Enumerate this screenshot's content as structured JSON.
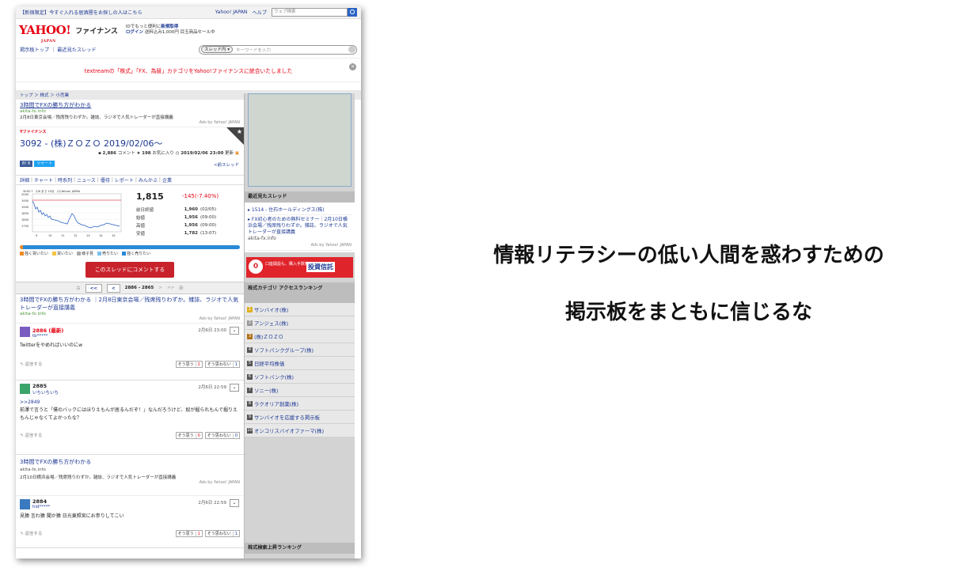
{
  "topbar": {
    "promo": "【新宿限定】今すぐ入れる居酒屋をお探しの人はこちら",
    "yahoo_link": "Yahoo! JAPAN",
    "help_link": "ヘルプ",
    "web_search_placeholder": "ウェブ検索"
  },
  "header": {
    "logo": "YAHOO!",
    "logo_sub": "JAPAN",
    "service": "ファイナンス",
    "login_line1": "IDでもっと便利に",
    "login_new": "新規取得",
    "login_label": "ログイン",
    "login_line2": "送料込み1,000円 目玉商品セール中"
  },
  "nav": {
    "links": "掲示板トップ ｜ 最近見たスレッド",
    "thread_scope": "スレッド内 ▾",
    "keyword_placeholder": "キーワードを入力"
  },
  "notice": {
    "text": "textreamの「株式」「FX、為替」カテゴリをYahoo!ファイナンスに統合いたしました"
  },
  "breadcrumb": "トップ ＞ 株式 ＞ 小売業",
  "ad1": {
    "title": "3時間でFXの勝ち方がわかる",
    "url": "akita-fx.info",
    "text": "2月8日東京会場／残席残りわずか。雑誌、ラジオで人気トレーダーが直接講義",
    "by": "Ads by Yahoo! JAPAN"
  },
  "stock": {
    "brand": "Yファイナンス",
    "title": "3092 - (株)ＺＯＺＯ 2019/02/06～",
    "comments": "2,886",
    "comments_label": "コメント",
    "favorites": "198",
    "favorites_label": "お気に入り",
    "updated": "2019/02/06 23:00",
    "updated_label": "更新",
    "fb": "B! 8",
    "tweet": "ツイート",
    "prev_thread": "<前スレッド"
  },
  "tabs": [
    "詳細",
    "チャート",
    "時系列",
    "ニュース",
    "優待",
    "レポート",
    "みんかぶ",
    "企業"
  ],
  "quote": {
    "price": "1,815",
    "change": "-145(-7.40%)",
    "chart_header": "3092.T　2/6 まで 15分　(C)Yahoo! JAPAN",
    "chart_y": [
      "2000",
      "1950",
      "1900",
      "1850",
      "1800",
      "1750"
    ],
    "chart_x": [
      "9",
      "10",
      "11",
      "12",
      "13",
      "14",
      "15"
    ],
    "rows": [
      {
        "label": "前日終値",
        "value": "1,960",
        "note": "(02/05)"
      },
      {
        "label": "始値",
        "value": "1,956",
        "note": "(09:00)"
      },
      {
        "label": "高値",
        "value": "1,956",
        "note": "(09:00)"
      },
      {
        "label": "安値",
        "value": "1,782",
        "note": "(13:07)"
      }
    ]
  },
  "sentiment_legend": [
    "強く買いたい",
    "買いたい",
    "様子見",
    "売りたい",
    "強く売りたい"
  ],
  "colors": {
    "sentiment": [
      "#f08a24",
      "#f5c342",
      "#aaaaaa",
      "#7cc0ee",
      "#2a8ad8"
    ],
    "accent_red": "#e60012",
    "link_blue": "#1d3994"
  },
  "comment_button": "このスレッドにコメントする",
  "pager": {
    "first": "古",
    "prev_all": "<<",
    "prev": "<",
    "range": "2886 - 2865",
    "next": ">",
    "next_all": ">>",
    "last": "新"
  },
  "ad2": {
    "title": "3時間でFXの勝ち方がわかる ｜2月8日東京会場／残席残りわずか。雑誌、ラジオで人気トレーダーが直接講義",
    "url": "akita-fx.info",
    "by": "Ads by Yahoo! JAPAN"
  },
  "posts": [
    {
      "num": "2886",
      "tag": "(最新)",
      "user": "tb*****",
      "time": "2月6日 23:00",
      "body": "Twitterをやめればいいのにw",
      "reply": "返信する",
      "agree": "そう思う",
      "agree_n": "2",
      "disagree": "そう思わない",
      "disagree_n": "1"
    },
    {
      "num": "2885",
      "tag": "",
      "user": "いちいちいち",
      "time": "2月6日 22:59",
      "quote": ">>2849",
      "body": "前澤で言うと「僕のバックにはほりえもんが居るんだぞ！」なんだろうけど、奴が掘られもんで掘りえもんじゃなくてよかったな？",
      "reply": "返信する",
      "agree": "そう思う",
      "agree_n": "0",
      "disagree": "そう思わない",
      "disagree_n": "0"
    },
    {
      "num": "2884",
      "tag": "",
      "user": "hid*****",
      "time": "2月6日 22:59",
      "body": "見猿 言わ猿 聞か猿 日光東照宮にお参りしてこい",
      "reply": "返信する",
      "agree": "そう思う",
      "agree_n": "1",
      "disagree": "そう思わない",
      "disagree_n": "1"
    }
  ],
  "ad3": {
    "title": "3時間でFXの勝ち方がわかる",
    "url": "akita-fx.info",
    "text": "2月10日横浜会場／残席残りわずか。雑誌、ラジオで人気トレーダーが直接講義",
    "by": "Ads by Yahoo! JAPAN"
  },
  "sidebar": {
    "recent_header": "最近見たスレッド",
    "recent": [
      "▸ 1514 - 住石ホールディングス(株)",
      "▸ FX初心者のための無料セミナー｜2月10日横浜会場／残席残りわずか。雑誌、ラジオで人気トレーダーが直接講義"
    ],
    "recent_url": "akita-fx.info",
    "recent_by": "Ads by Yahoo! JAPAN",
    "banner_zero": "0",
    "banner_text": "口座開設も、購入手数料も。",
    "banner_brand": "投資信託",
    "rank_header": "株式カテゴリ アクセスランキング",
    "ranking": [
      "サンバイオ(株)",
      "アンジェス(株)",
      "(株)ＺＯＺＯ",
      "ソフトバンクグループ(株)",
      "日経平均株価",
      "ソフトバンク(株)",
      "ソニー(株)",
      "ラクオリア創薬(株)",
      "サンバイオを応援する掲示板",
      "オンコリスバイオファーマ(株)"
    ],
    "bottom_header": "株式検索上昇ランキング"
  },
  "caption": {
    "line1": "情報リテラシーの低い人間を惑わすための",
    "line2": "掲示板をまともに信じるな"
  }
}
